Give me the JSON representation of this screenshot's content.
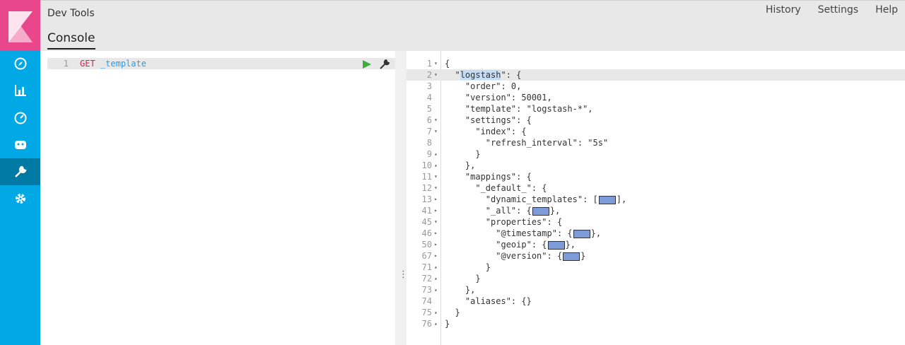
{
  "app": {
    "title": "Dev Tools",
    "page_title": "Console"
  },
  "top_links": [
    "History",
    "Settings",
    "Help"
  ],
  "editor": {
    "line_number": "1",
    "method": "GET",
    "url": "_template"
  },
  "output": {
    "lines": [
      {
        "n": "1",
        "fold": "▾",
        "text": "{"
      },
      {
        "n": "2",
        "fold": "▾",
        "text": "  \"logstash\": {"
      },
      {
        "n": "3",
        "fold": "",
        "text": "    \"order\": 0,"
      },
      {
        "n": "4",
        "fold": "",
        "text": "    \"version\": 50001,"
      },
      {
        "n": "5",
        "fold": "",
        "text": "    \"template\": \"logstash-*\","
      },
      {
        "n": "6",
        "fold": "▾",
        "text": "    \"settings\": {"
      },
      {
        "n": "7",
        "fold": "▾",
        "text": "      \"index\": {"
      },
      {
        "n": "8",
        "fold": "",
        "text": "        \"refresh_interval\": \"5s\""
      },
      {
        "n": "9",
        "fold": "▴",
        "text": "      }"
      },
      {
        "n": "10",
        "fold": "▴",
        "text": "    },"
      },
      {
        "n": "11",
        "fold": "▾",
        "text": "    \"mappings\": {"
      },
      {
        "n": "12",
        "fold": "▾",
        "text": "      \"_default_\": {"
      },
      {
        "n": "13",
        "fold": "▸",
        "text": "        \"dynamic_templates\": [",
        "tail": "],"
      },
      {
        "n": "41",
        "fold": "▸",
        "text": "        \"_all\": {",
        "tail": "},"
      },
      {
        "n": "45",
        "fold": "▾",
        "text": "        \"properties\": {"
      },
      {
        "n": "46",
        "fold": "▸",
        "text": "          \"@timestamp\": {",
        "tail": "},"
      },
      {
        "n": "50",
        "fold": "▸",
        "text": "          \"geoip\": {",
        "tail": "},"
      },
      {
        "n": "67",
        "fold": "▸",
        "text": "          \"@version\": {",
        "tail": "}"
      },
      {
        "n": "71",
        "fold": "▴",
        "text": "        }"
      },
      {
        "n": "72",
        "fold": "▴",
        "text": "      }"
      },
      {
        "n": "73",
        "fold": "▴",
        "text": "    },"
      },
      {
        "n": "74",
        "fold": "",
        "text": "    \"aliases\": {}"
      },
      {
        "n": "75",
        "fold": "▴",
        "text": "  }"
      },
      {
        "n": "76",
        "fold": "▴",
        "text": "}"
      }
    ]
  },
  "colors": {
    "sidebar": "#00a9e5",
    "logo": "#e8488b",
    "active": "#0079a5"
  },
  "icons": [
    "compass-icon",
    "bar-chart-icon",
    "dashboard-icon",
    "timelion-icon",
    "wrench-icon",
    "gear-icon"
  ]
}
